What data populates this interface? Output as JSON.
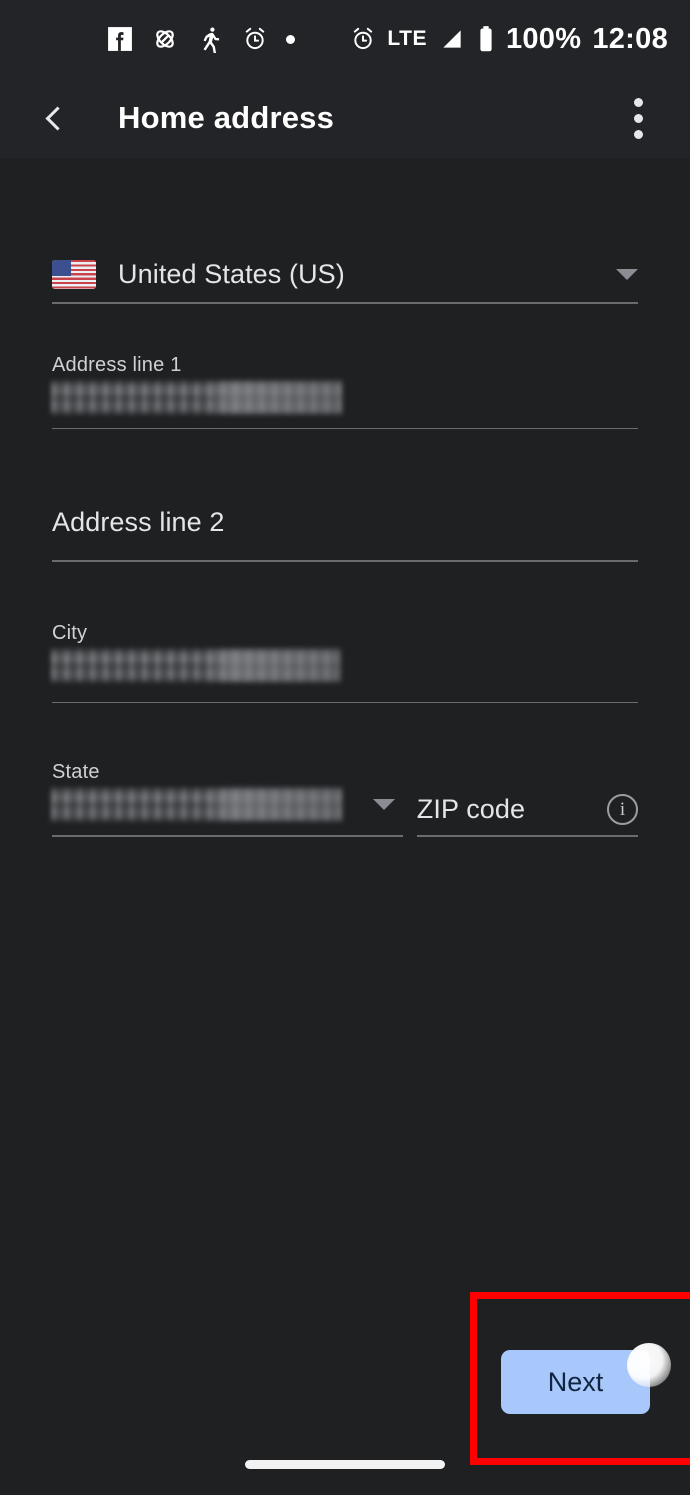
{
  "status_bar": {
    "left_icons": [
      "facebook-icon",
      "link-icon",
      "running-person-icon",
      "alarm-clock-icon",
      "dot-icon"
    ],
    "alarm_icon": "alarm-clock-icon",
    "network": "LTE",
    "signal_icon": "signal-triangle-icon",
    "battery_icon": "battery-full-icon",
    "battery_level": "100%",
    "time": "12:08"
  },
  "app_bar": {
    "back_icon": "back-chevron-icon",
    "title": "Home address",
    "overflow_icon": "more-vertical-icon"
  },
  "form": {
    "country": {
      "flag_icon": "us-flag-icon",
      "value": "United States (US)",
      "caret_icon": "chevron-down-icon"
    },
    "address_line_1": {
      "label": "Address line 1",
      "value": "",
      "redacted": true
    },
    "address_line_2": {
      "placeholder": "Address line 2",
      "value": ""
    },
    "city": {
      "label": "City",
      "value": "",
      "redacted": true
    },
    "state": {
      "label": "State",
      "value": "",
      "redacted": true,
      "caret_icon": "chevron-down-icon"
    },
    "zip": {
      "placeholder": "ZIP code",
      "value": "",
      "info_icon": "info-circle-icon",
      "info_glyph": "i"
    }
  },
  "footer": {
    "next_label": "Next",
    "highlight_color": "#fe0000",
    "button_color": "#a8c7fa",
    "button_text_color": "#10253f",
    "touch_indicator": "tap-indicator"
  }
}
